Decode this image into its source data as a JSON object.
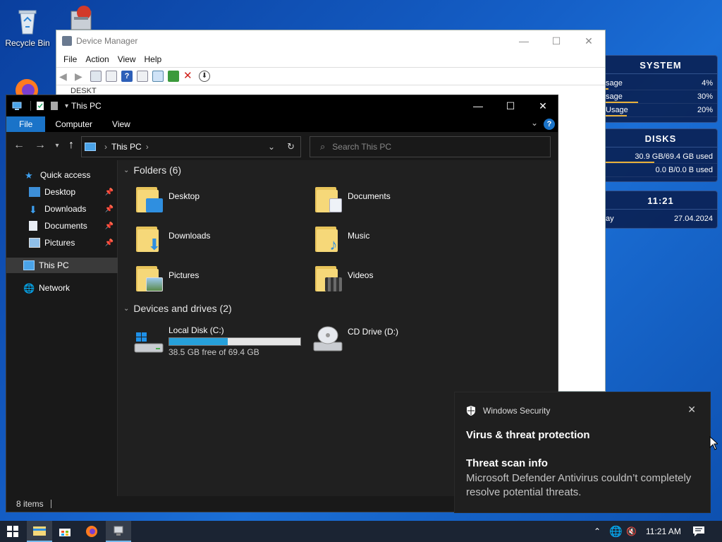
{
  "desktop": {
    "icons": [
      {
        "label": "Recycle Bin"
      }
    ]
  },
  "widgets": {
    "system": {
      "title": "SYSTEM",
      "rows": [
        {
          "label": "sage",
          "value": "4%",
          "level": 0.04
        },
        {
          "label": "sage",
          "value": "30%",
          "level": 0.3
        },
        {
          "label": "Usage",
          "value": "20%",
          "level": 0.2
        }
      ]
    },
    "disks": {
      "title": "DISKS",
      "rows": [
        {
          "label": "",
          "value": "30.9 GB/69.4 GB used",
          "level": 0.445
        },
        {
          "label": "",
          "value": "0.0 B/0.0 B used",
          "level": 0
        }
      ]
    },
    "clock": {
      "time": "11:21",
      "day_label": "ay",
      "date": "27.04.2024"
    }
  },
  "device_manager": {
    "title": "Device Manager",
    "menu": [
      "File",
      "Action",
      "View",
      "Help"
    ],
    "tree_fragment": "DESKT"
  },
  "explorer": {
    "title": "This PC",
    "ribbon_tabs": [
      "File",
      "Computer",
      "View"
    ],
    "help_label": "?",
    "address_path": "This PC",
    "search_placeholder": "Search This PC",
    "nav": {
      "quick_access": "Quick access",
      "pinned": [
        "Desktop",
        "Downloads",
        "Documents",
        "Pictures"
      ],
      "this_pc": "This PC",
      "network": "Network"
    },
    "folders_header": "Folders (6)",
    "folders": [
      "Desktop",
      "Documents",
      "Downloads",
      "Music",
      "Pictures",
      "Videos"
    ],
    "drives_header": "Devices and drives (2)",
    "drives": [
      {
        "name": "Local Disk (C:)",
        "free_text": "38.5 GB free of 69.4 GB",
        "used_fraction": 0.445
      },
      {
        "name": "CD Drive (D:)"
      }
    ],
    "status_text": "8 items"
  },
  "toast": {
    "app": "Windows Security",
    "heading": "Virus & threat protection",
    "subheading": "Threat scan info",
    "body": "Microsoft Defender Antivirus couldn’t completely resolve potential threats."
  },
  "taskbar": {
    "time": "11:21 AM"
  },
  "colors": {
    "accent": "#1a73c8",
    "disk_fill": "#26a0da",
    "folder": "#f6d879"
  }
}
